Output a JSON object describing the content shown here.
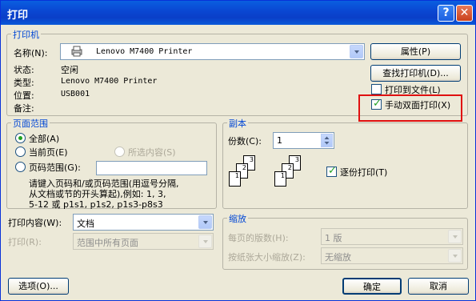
{
  "window": {
    "title": "打印",
    "help_glyph": "?",
    "close_glyph": "✕"
  },
  "printer": {
    "legend": "打印机",
    "name_label": "名称(N):",
    "name_value": "Lenovo M7400 Printer",
    "status_label": "状态:",
    "status_value": "空闲",
    "type_label": "类型:",
    "type_value": "Lenovo M7400 Printer",
    "location_label": "位置:",
    "location_value": "USB001",
    "comment_label": "备注:",
    "properties_button": "属性(P)",
    "find_printer_button": "查找打印机(D)...",
    "print_to_file_label": "打印到文件(L)",
    "manual_duplex_label": "手动双面打印(X)",
    "print_to_file_checked": false,
    "manual_duplex_checked": true
  },
  "page_range": {
    "legend": "页面范围",
    "all_label": "全部(A)",
    "current_label": "当前页(E)",
    "selection_label": "所选内容(S)",
    "pages_label": "页码范围(G):",
    "pages_value": "",
    "help_line1": "请键入页码和/或页码范围(用逗号分隔,",
    "help_line2": "从文档或节的开头算起),例如: 1, 3,",
    "help_line3": "5-12 或 p1s1, p1s2, p1s3-p8s3"
  },
  "copies": {
    "legend": "副本",
    "count_label": "份数(C):",
    "count_value": "1",
    "collate_label": "逐份打印(T)",
    "collate_checked": true
  },
  "print_what": {
    "label": "打印内容(W):",
    "value": "文档",
    "print_label": "打印(R):",
    "print_value": "范围中所有页面"
  },
  "zoom": {
    "legend": "缩放",
    "pages_per_sheet_label": "每页的版数(H):",
    "pages_per_sheet_value": "1 版",
    "scale_label": "按纸张大小缩放(Z):",
    "scale_value": "无缩放"
  },
  "footer": {
    "options_button": "选项(O)...",
    "ok_button": "确定",
    "cancel_button": "取消"
  },
  "colors": {
    "accent": "#0046d5",
    "highlight_box": "#e01010"
  }
}
